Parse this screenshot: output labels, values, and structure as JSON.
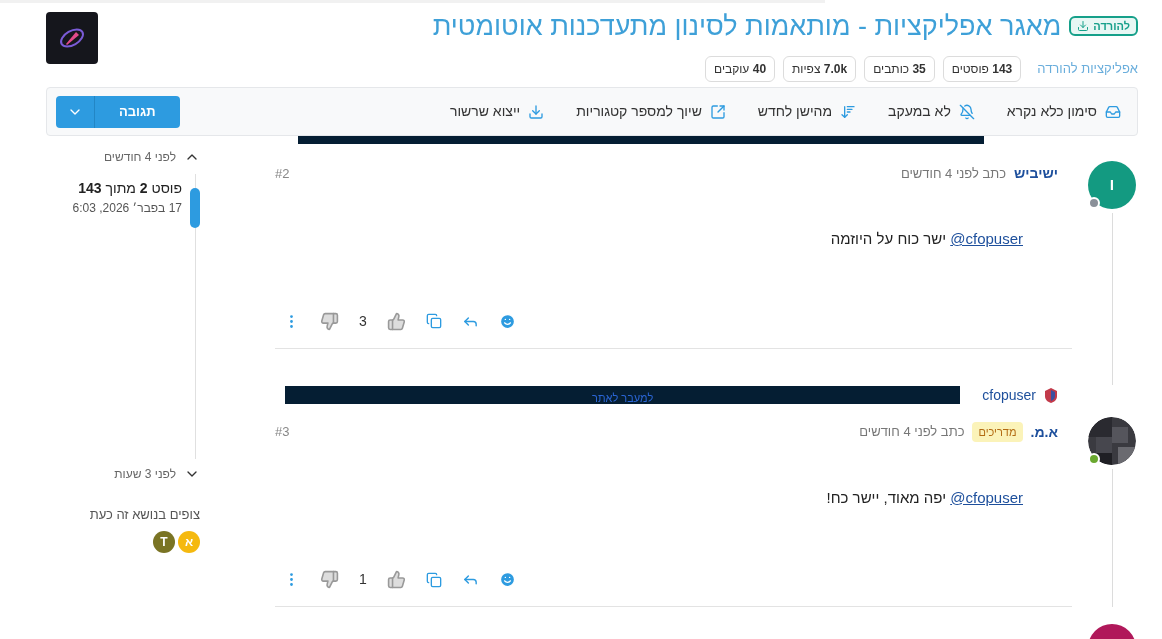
{
  "header": {
    "badge": "להורדה",
    "title": "מאגר אפליקציות - מותאמות לסינון מתעדכנות אוטומטית",
    "category": "אפליקציות להורדה",
    "stats": [
      {
        "value": "143",
        "label": "פוסטים"
      },
      {
        "value": "35",
        "label": "כותבים"
      },
      {
        "value": "7.0k",
        "label": "צפיות"
      },
      {
        "value": "40",
        "label": "עוקבים"
      }
    ]
  },
  "toolbar": {
    "items": [
      {
        "kind": "inbox",
        "label": "סימון כלא נקרא"
      },
      {
        "kind": "bell-off",
        "label": "לא במעקב"
      },
      {
        "kind": "sort",
        "label": "מהישן לחדש"
      },
      {
        "kind": "external",
        "label": "שיוך למספר קטגוריות"
      },
      {
        "kind": "download",
        "label": "ייצוא שרשור"
      }
    ],
    "reply_button": "תגובה"
  },
  "posts": [
    {
      "number": "#2",
      "author": "ישיביש",
      "time": "כתב לפני 4 חודשים",
      "avatar": {
        "kind": "letter",
        "letter": "ו",
        "color": "#139a81"
      },
      "online": false,
      "mention": "@cfopuser",
      "text": "ישר כוח על היוזמה",
      "votes": "3"
    },
    {
      "number": "#3",
      "author": "א.מ.",
      "badge": "מדריכים",
      "time": "כתב לפני 4 חודשים",
      "online": true,
      "banner": {
        "sponsor": "cfopuser",
        "link": "למעבר לאתר"
      },
      "mention": "@cfopuser",
      "text": "יפה מאוד, יישר כח!",
      "votes": "1"
    },
    {
      "avatar": {
        "kind": "letter",
        "color": "#b0185a"
      }
    }
  ],
  "timeline": {
    "top": "לפני 4 חודשים",
    "position": "פוסט **2** מתוך **143**",
    "date": "17 בפבר׳ 2026, 6:03",
    "bottom": "לפני 3 שעות",
    "level": 0.05
  },
  "viewers": {
    "title": "צופים בנושא זה כעת",
    "users": [
      {
        "letter": "א",
        "color": "#f5b90f"
      },
      {
        "letter": "T",
        "color": "#7a7424"
      }
    ]
  }
}
